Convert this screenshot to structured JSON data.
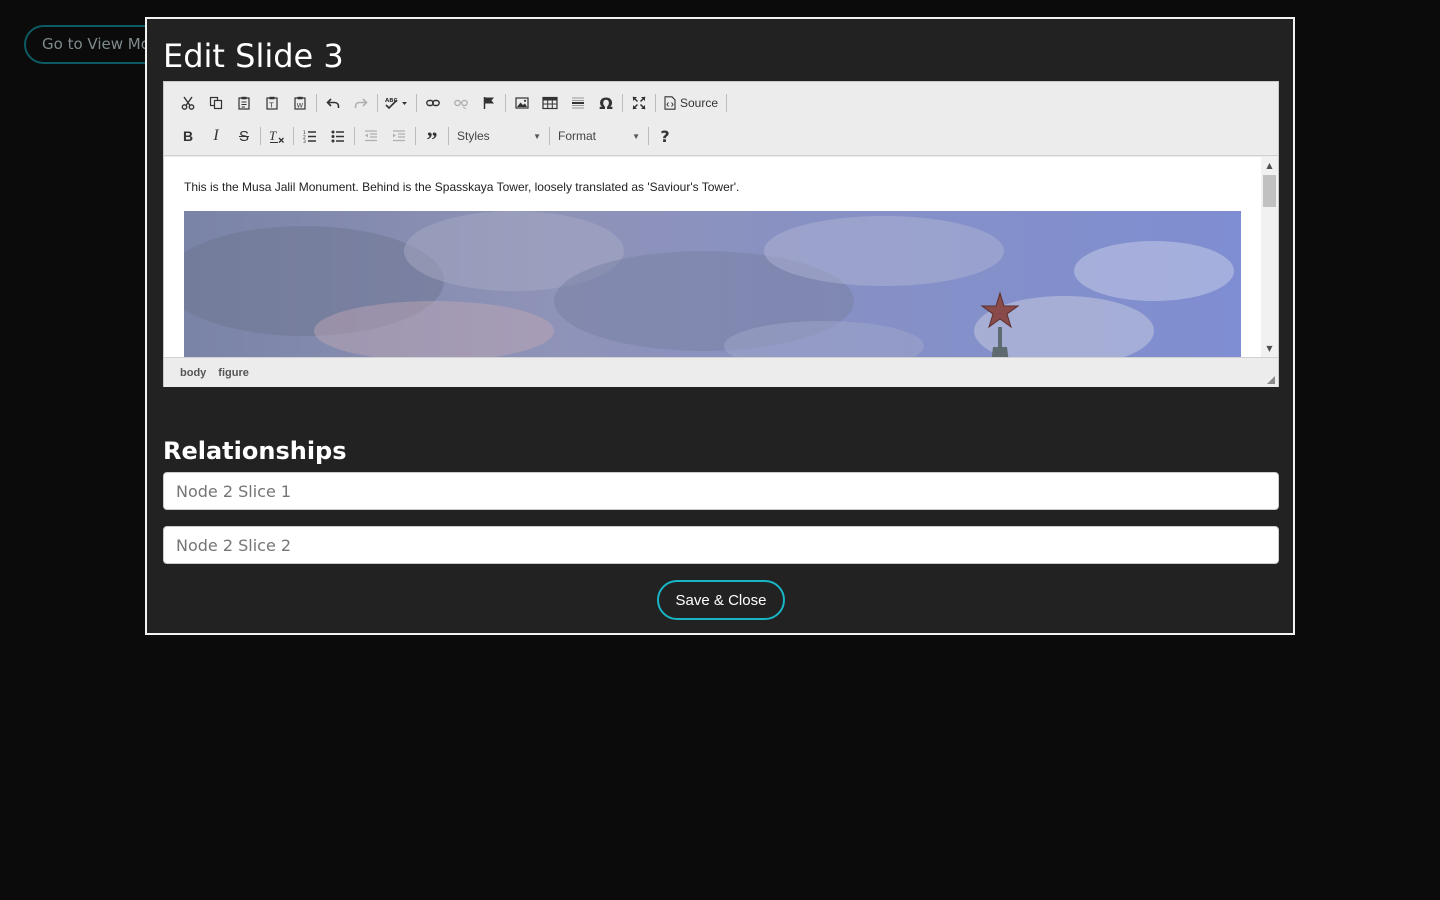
{
  "background": {
    "button_label": "Go to View Mode"
  },
  "modal": {
    "title": "Edit Slide 3",
    "editor": {
      "toolbar_row1": [
        {
          "icon": "cut-icon"
        },
        {
          "icon": "copy-icon"
        },
        {
          "icon": "paste-icon"
        },
        {
          "icon": "paste-text-icon"
        },
        {
          "icon": "paste-word-icon"
        },
        {
          "icon": "undo-icon"
        },
        {
          "icon": "redo-icon"
        },
        {
          "icon": "spellcheck-icon"
        },
        {
          "icon": "link-icon"
        },
        {
          "icon": "unlink-icon"
        },
        {
          "icon": "anchor-icon"
        },
        {
          "icon": "image-icon"
        },
        {
          "icon": "table-icon"
        },
        {
          "icon": "horizontal-line-icon"
        },
        {
          "icon": "special-char-icon"
        },
        {
          "icon": "maximize-icon"
        }
      ],
      "source_label": "Source",
      "toolbar_row2": [
        {
          "icon": "bold-icon"
        },
        {
          "icon": "italic-icon"
        },
        {
          "icon": "strike-icon"
        },
        {
          "icon": "remove-format-icon"
        },
        {
          "icon": "numbered-list-icon"
        },
        {
          "icon": "bulleted-list-icon"
        },
        {
          "icon": "outdent-icon"
        },
        {
          "icon": "indent-icon"
        },
        {
          "icon": "blockquote-icon"
        }
      ],
      "styles_label": "Styles",
      "format_label": "Format",
      "help_label": "?",
      "content_text": "This is the Musa Jalil Monument. Behind is the Spasskaya Tower, loosely translated as 'Saviour's Tower'.",
      "path": [
        "body",
        "figure"
      ]
    },
    "relationships": {
      "title": "Relationships",
      "fields": [
        {
          "placeholder": "Node 2 Slice 1"
        },
        {
          "placeholder": "Node 2 Slice 2"
        }
      ]
    },
    "save_label": "Save & Close"
  },
  "colors": {
    "accent": "#18b5c4",
    "modal_bg": "#222222",
    "page_bg": "#0b0b0b"
  }
}
